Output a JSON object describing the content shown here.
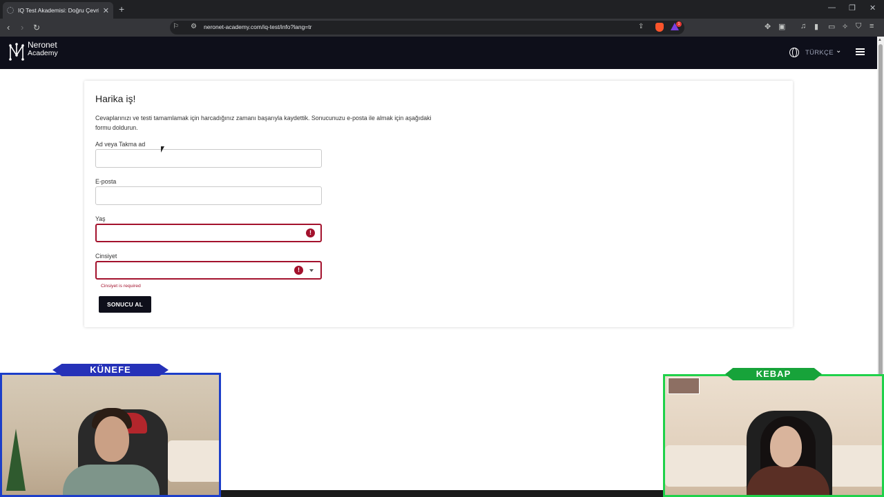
{
  "browser": {
    "tab_title": "IQ Test Akademisi: Doğru Çevrim",
    "url": "neronet-academy.com/iq-test/info?lang=tr",
    "brave_badge_count": "1"
  },
  "site": {
    "logo_line1": "Neronet",
    "logo_line2": "Academy",
    "language": "TÜRKÇE"
  },
  "form": {
    "title": "Harika iş!",
    "description": "Cevaplarınızı ve testi tamamlamak için harcadığınız zamanı başarıyla kaydettik. Sonucunuzu e-posta ile almak için aşağıdaki formu doldurun.",
    "name_label": "Ad veya Takma ad",
    "name_value": "",
    "email_label": "E-posta",
    "email_value": "",
    "age_label": "Yaş",
    "age_value": "",
    "gender_label": "Cinsiyet",
    "gender_value": "",
    "gender_error": "Cinsiyet is required",
    "submit_label": "SONUCU AL"
  },
  "overlays": {
    "left_cam_tag": "KÜNEFE",
    "right_cam_tag": "KEBAP"
  },
  "colors": {
    "header_bg": "#0e0f1a",
    "error": "#a3112c",
    "left_cam_border": "#1c3ec9",
    "right_cam_border": "#1fd14a"
  }
}
